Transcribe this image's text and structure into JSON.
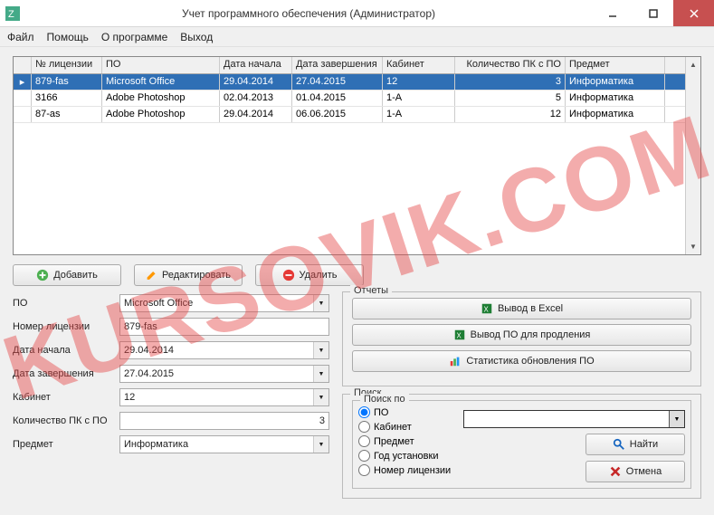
{
  "window": {
    "title": "Учет программного обеспечения (Администратор)"
  },
  "menu": {
    "file": "Файл",
    "help": "Помощь",
    "about": "О программе",
    "exit": "Выход"
  },
  "grid": {
    "headers": {
      "license": "№ лицензии",
      "po": "ПО",
      "start": "Дата начала",
      "end": "Дата завершения",
      "room": "Кабинет",
      "count": "Количество ПК с ПО",
      "subject": "Предмет"
    },
    "rows": [
      {
        "license": "879-fas",
        "po": "Microsoft Office",
        "start": "29.04.2014",
        "end": "27.04.2015",
        "room": "12",
        "count": "3",
        "subject": "Информатика"
      },
      {
        "license": "3166",
        "po": "Adobe Photoshop",
        "start": "02.04.2013",
        "end": "01.04.2015",
        "room": "1-А",
        "count": "5",
        "subject": "Информатика"
      },
      {
        "license": "87-as",
        "po": "Adobe Photoshop",
        "start": "29.04.2014",
        "end": "06.06.2015",
        "room": "1-А",
        "count": "12",
        "subject": "Информатика"
      }
    ]
  },
  "buttons": {
    "add": "Добавить",
    "edit": "Редактировать",
    "delete": "Удалить"
  },
  "form": {
    "po_label": "ПО",
    "po_value": "Microsoft Office",
    "license_label": "Номер лицензии",
    "license_value": "879-fas",
    "start_label": "Дата начала",
    "start_value": "29.04.2014",
    "end_label": "Дата завершения",
    "end_value": "27.04.2015",
    "room_label": "Кабинет",
    "room_value": "12",
    "count_label": "Количество ПК с ПО",
    "count_value": "3",
    "subject_label": "Предмет",
    "subject_value": "Информатика"
  },
  "reports": {
    "legend": "Отчеты",
    "excel": "Вывод в Excel",
    "extend": "Вывод ПО для продления",
    "stats": "Статистика обновления ПО"
  },
  "search": {
    "legend": "Поиск",
    "by_legend": "Поиск по",
    "opt_po": "ПО",
    "opt_room": "Кабинет",
    "opt_subject": "Предмет",
    "opt_year": "Год установки",
    "opt_license": "Номер лицензии",
    "find": "Найти",
    "cancel": "Отмена"
  },
  "watermark": "KURSOVIK.COM"
}
